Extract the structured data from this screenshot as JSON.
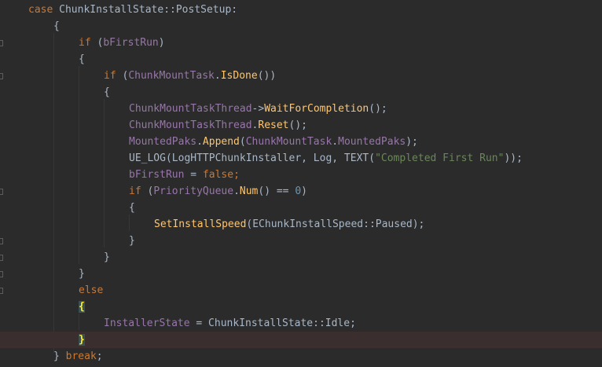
{
  "code": {
    "l0": {
      "kw": "case",
      "t1": " ChunkInstallState::PostSetup:"
    },
    "l1": {
      "t": "{"
    },
    "l2": {
      "kw": "if",
      "t1": " (",
      "var": "bFirstRun",
      "t2": ")"
    },
    "l3": {
      "t": "{"
    },
    "l4": {
      "kw": "if",
      "t1": " (",
      "mem1": "ChunkMountTask",
      "t2": ".",
      "fn1": "IsDone",
      "t3": "())"
    },
    "l5": {
      "t": "{"
    },
    "l6": {
      "mem1": "ChunkMountTaskThread",
      "t1": "->",
      "fn1": "WaitForCompletion",
      "t2": "();"
    },
    "l7": {
      "mem1": "ChunkMountTaskThread",
      "t1": ".",
      "fn1": "Reset",
      "t2": "();"
    },
    "l8": {
      "mem1": "MountedPaks",
      "t1": ".",
      "fn1": "Append",
      "t2": "(",
      "mem2": "ChunkMountTask",
      "t3": ".",
      "mem3": "MountedPaks",
      "t4": ");"
    },
    "l9": {
      "t1": "UE_LOG(LogHTTPChunkInstaller, Log, TEXT(",
      "str": "\"Completed First Run\"",
      "t2": "));"
    },
    "l10": {
      "mem1": "bFirstRun",
      "t1": " = ",
      "kw": "false",
      "t2": ";"
    },
    "l11": {
      "kw": "if",
      "t1": " (",
      "mem1": "PriorityQueue",
      "t2": ".",
      "fn1": "Num",
      "t3": "() == ",
      "num": "0",
      "t4": ")"
    },
    "l12": {
      "t": "{"
    },
    "l13": {
      "fn1": "SetInstallSpeed",
      "t1": "(EChunkInstallSpeed::Paused);"
    },
    "l14": {
      "t": "}"
    },
    "l15": {
      "t": "}"
    },
    "l16": {
      "t": "}"
    },
    "l17": {
      "kw": "else"
    },
    "l18": {
      "t": "{"
    },
    "l19": {
      "mem1": "InstallerState",
      "t1": " = ChunkInstallState::Idle;"
    },
    "l20": {
      "t": "}"
    },
    "l21": {
      "t1": "} ",
      "kw": "break",
      "t2": ";"
    }
  }
}
